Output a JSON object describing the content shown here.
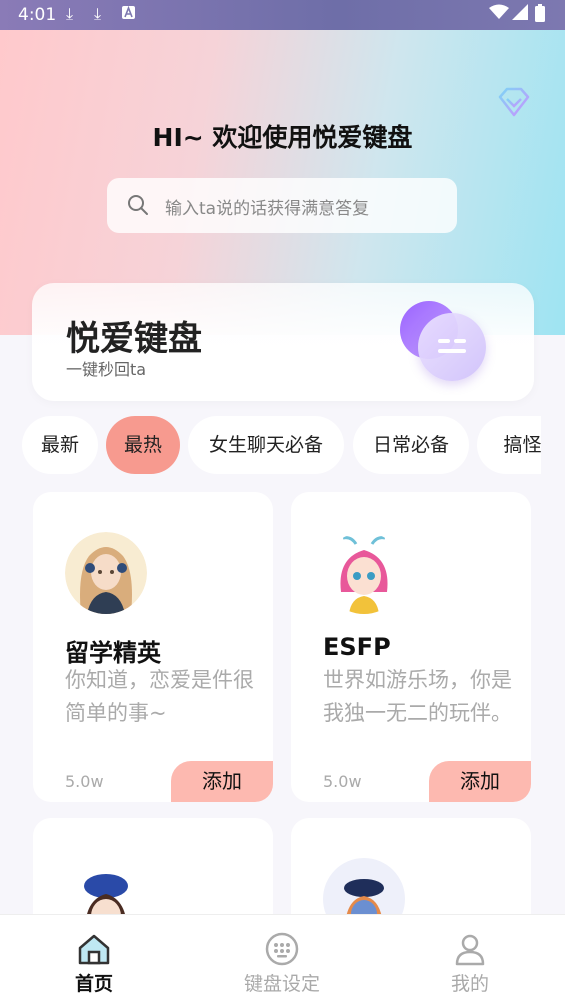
{
  "status_bar": {
    "time": "4:01"
  },
  "header": {
    "title": "HI~ 欢迎使用悦爱键盘",
    "search_placeholder": "输入ta说的话获得满意答复"
  },
  "feature_card": {
    "name": "悦爱键盘",
    "subtitle": "一键秒回ta"
  },
  "tabs": [
    {
      "label": "最新",
      "active": false
    },
    {
      "label": "最热",
      "active": true
    },
    {
      "label": "女生聊天必备",
      "active": false
    },
    {
      "label": "日常必备",
      "active": false
    },
    {
      "label": "搞怪幽",
      "active": false
    }
  ],
  "cards": [
    {
      "name": "留学精英",
      "desc": "你知道，恋爱是件很简单的事~",
      "count": "5.0w",
      "add_label": "添加"
    },
    {
      "name": "ESFP",
      "desc": "世界如游乐场，你是我独一无二的玩伴。",
      "count": "5.0w",
      "add_label": "添加"
    }
  ],
  "bottom_nav": [
    {
      "label": "首页",
      "icon": "home-icon",
      "active": true
    },
    {
      "label": "键盘设定",
      "icon": "keyboard-icon",
      "active": false
    },
    {
      "label": "我的",
      "icon": "user-icon",
      "active": false
    }
  ],
  "colors": {
    "accent": "#f79a8f",
    "add_button": "#fdb9b0",
    "hero_left": "#ffc9cc",
    "hero_right": "#9ee4f2"
  }
}
